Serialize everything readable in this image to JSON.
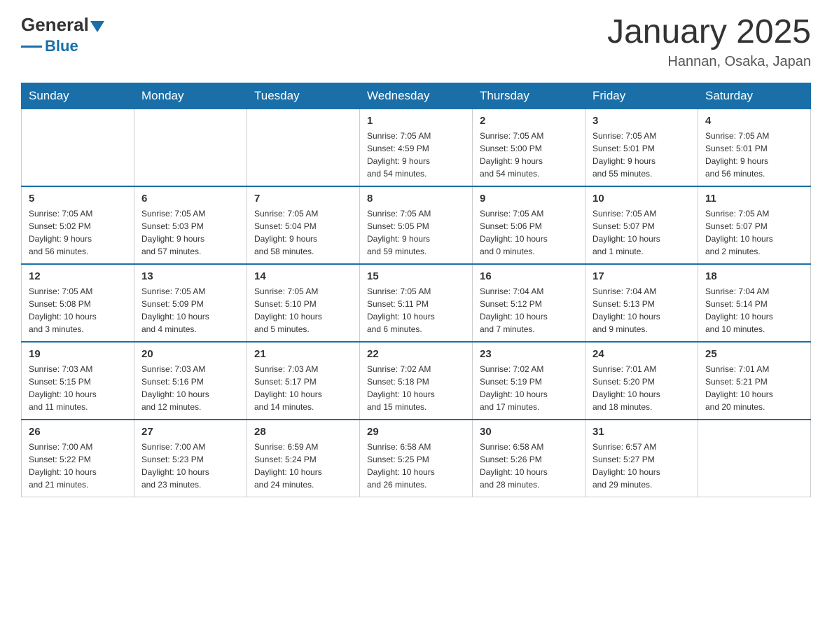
{
  "header": {
    "logo_text_general": "General",
    "logo_text_blue": "Blue",
    "month_title": "January 2025",
    "location": "Hannan, Osaka, Japan"
  },
  "weekdays": [
    "Sunday",
    "Monday",
    "Tuesday",
    "Wednesday",
    "Thursday",
    "Friday",
    "Saturday"
  ],
  "weeks": [
    [
      {
        "day": "",
        "info": ""
      },
      {
        "day": "",
        "info": ""
      },
      {
        "day": "",
        "info": ""
      },
      {
        "day": "1",
        "info": "Sunrise: 7:05 AM\nSunset: 4:59 PM\nDaylight: 9 hours\nand 54 minutes."
      },
      {
        "day": "2",
        "info": "Sunrise: 7:05 AM\nSunset: 5:00 PM\nDaylight: 9 hours\nand 54 minutes."
      },
      {
        "day": "3",
        "info": "Sunrise: 7:05 AM\nSunset: 5:01 PM\nDaylight: 9 hours\nand 55 minutes."
      },
      {
        "day": "4",
        "info": "Sunrise: 7:05 AM\nSunset: 5:01 PM\nDaylight: 9 hours\nand 56 minutes."
      }
    ],
    [
      {
        "day": "5",
        "info": "Sunrise: 7:05 AM\nSunset: 5:02 PM\nDaylight: 9 hours\nand 56 minutes."
      },
      {
        "day": "6",
        "info": "Sunrise: 7:05 AM\nSunset: 5:03 PM\nDaylight: 9 hours\nand 57 minutes."
      },
      {
        "day": "7",
        "info": "Sunrise: 7:05 AM\nSunset: 5:04 PM\nDaylight: 9 hours\nand 58 minutes."
      },
      {
        "day": "8",
        "info": "Sunrise: 7:05 AM\nSunset: 5:05 PM\nDaylight: 9 hours\nand 59 minutes."
      },
      {
        "day": "9",
        "info": "Sunrise: 7:05 AM\nSunset: 5:06 PM\nDaylight: 10 hours\nand 0 minutes."
      },
      {
        "day": "10",
        "info": "Sunrise: 7:05 AM\nSunset: 5:07 PM\nDaylight: 10 hours\nand 1 minute."
      },
      {
        "day": "11",
        "info": "Sunrise: 7:05 AM\nSunset: 5:07 PM\nDaylight: 10 hours\nand 2 minutes."
      }
    ],
    [
      {
        "day": "12",
        "info": "Sunrise: 7:05 AM\nSunset: 5:08 PM\nDaylight: 10 hours\nand 3 minutes."
      },
      {
        "day": "13",
        "info": "Sunrise: 7:05 AM\nSunset: 5:09 PM\nDaylight: 10 hours\nand 4 minutes."
      },
      {
        "day": "14",
        "info": "Sunrise: 7:05 AM\nSunset: 5:10 PM\nDaylight: 10 hours\nand 5 minutes."
      },
      {
        "day": "15",
        "info": "Sunrise: 7:05 AM\nSunset: 5:11 PM\nDaylight: 10 hours\nand 6 minutes."
      },
      {
        "day": "16",
        "info": "Sunrise: 7:04 AM\nSunset: 5:12 PM\nDaylight: 10 hours\nand 7 minutes."
      },
      {
        "day": "17",
        "info": "Sunrise: 7:04 AM\nSunset: 5:13 PM\nDaylight: 10 hours\nand 9 minutes."
      },
      {
        "day": "18",
        "info": "Sunrise: 7:04 AM\nSunset: 5:14 PM\nDaylight: 10 hours\nand 10 minutes."
      }
    ],
    [
      {
        "day": "19",
        "info": "Sunrise: 7:03 AM\nSunset: 5:15 PM\nDaylight: 10 hours\nand 11 minutes."
      },
      {
        "day": "20",
        "info": "Sunrise: 7:03 AM\nSunset: 5:16 PM\nDaylight: 10 hours\nand 12 minutes."
      },
      {
        "day": "21",
        "info": "Sunrise: 7:03 AM\nSunset: 5:17 PM\nDaylight: 10 hours\nand 14 minutes."
      },
      {
        "day": "22",
        "info": "Sunrise: 7:02 AM\nSunset: 5:18 PM\nDaylight: 10 hours\nand 15 minutes."
      },
      {
        "day": "23",
        "info": "Sunrise: 7:02 AM\nSunset: 5:19 PM\nDaylight: 10 hours\nand 17 minutes."
      },
      {
        "day": "24",
        "info": "Sunrise: 7:01 AM\nSunset: 5:20 PM\nDaylight: 10 hours\nand 18 minutes."
      },
      {
        "day": "25",
        "info": "Sunrise: 7:01 AM\nSunset: 5:21 PM\nDaylight: 10 hours\nand 20 minutes."
      }
    ],
    [
      {
        "day": "26",
        "info": "Sunrise: 7:00 AM\nSunset: 5:22 PM\nDaylight: 10 hours\nand 21 minutes."
      },
      {
        "day": "27",
        "info": "Sunrise: 7:00 AM\nSunset: 5:23 PM\nDaylight: 10 hours\nand 23 minutes."
      },
      {
        "day": "28",
        "info": "Sunrise: 6:59 AM\nSunset: 5:24 PM\nDaylight: 10 hours\nand 24 minutes."
      },
      {
        "day": "29",
        "info": "Sunrise: 6:58 AM\nSunset: 5:25 PM\nDaylight: 10 hours\nand 26 minutes."
      },
      {
        "day": "30",
        "info": "Sunrise: 6:58 AM\nSunset: 5:26 PM\nDaylight: 10 hours\nand 28 minutes."
      },
      {
        "day": "31",
        "info": "Sunrise: 6:57 AM\nSunset: 5:27 PM\nDaylight: 10 hours\nand 29 minutes."
      },
      {
        "day": "",
        "info": ""
      }
    ]
  ]
}
